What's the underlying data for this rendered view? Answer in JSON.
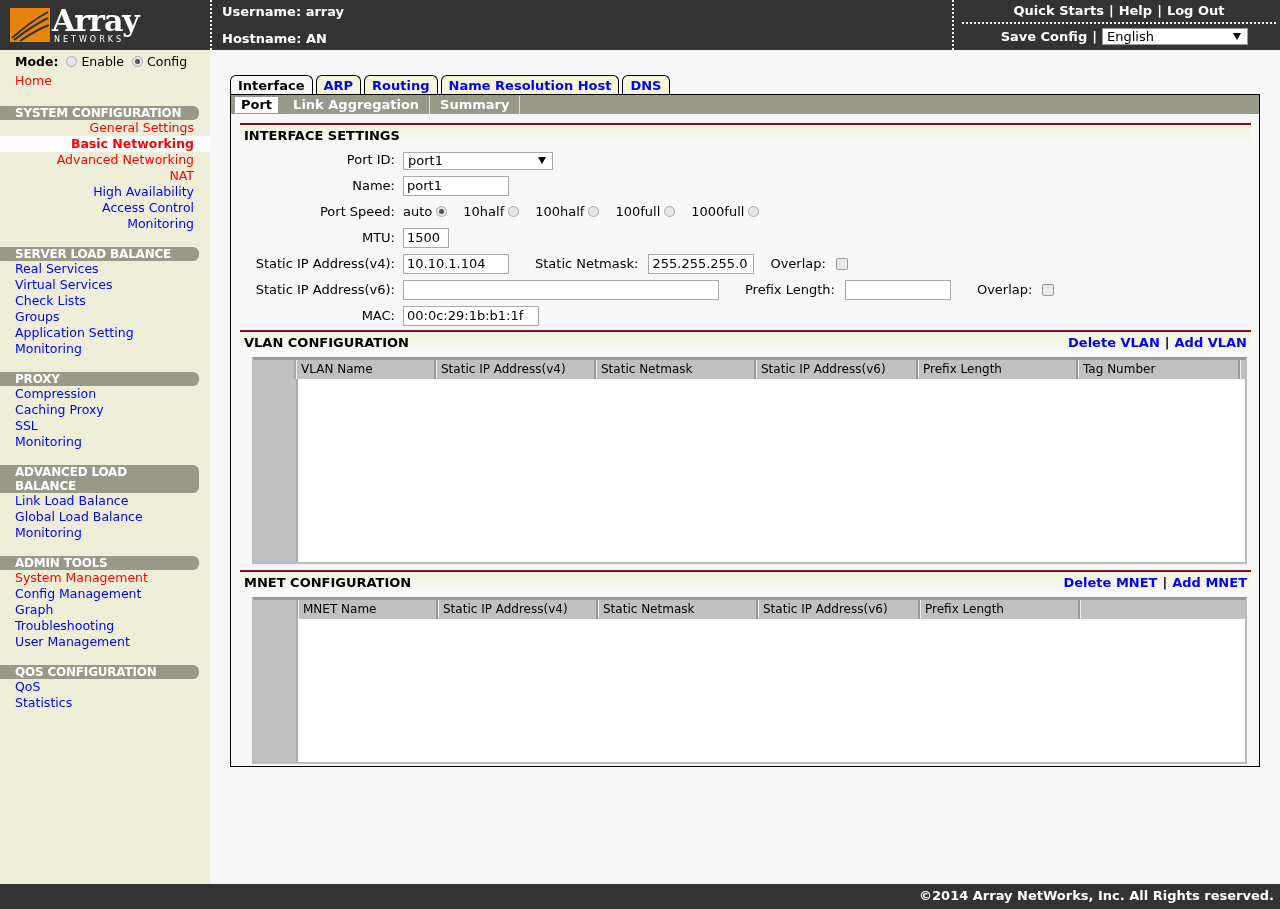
{
  "header": {
    "logo": {
      "word": "Array",
      "subword": "NETWORKS"
    },
    "username": "Username: array",
    "hostname": "Hostname: AN",
    "top_links": [
      "Quick Starts",
      "Help",
      "Log Out"
    ],
    "top_separators": [
      "|",
      "|"
    ],
    "save_config": "Save Config",
    "save_separator": "|",
    "language": {
      "value": "English"
    }
  },
  "sidebar": {
    "mode_label": "Mode:",
    "modes": [
      {
        "label": "Enable",
        "selected": false
      },
      {
        "label": "Config",
        "selected": true
      }
    ],
    "home": {
      "label": "Home",
      "color": "#ff0000"
    },
    "sections": [
      {
        "title": "SYSTEM CONFIGURATION",
        "kind": "right",
        "items": [
          {
            "label": "General Settings",
            "color": "#ff0000",
            "selected": false
          },
          {
            "label": "Basic Networking",
            "color": "#ff0000",
            "selected": true
          },
          {
            "label": "Advanced Networking",
            "color": "#ff0000",
            "selected": false
          },
          {
            "label": "NAT",
            "color": "#ff0000",
            "selected": false
          },
          {
            "label": "High Availability",
            "color": "#0000ff",
            "selected": false
          },
          {
            "label": "Access Control",
            "color": "#0000ff",
            "selected": false
          },
          {
            "label": "Monitoring",
            "color": "#0000ff",
            "selected": false
          }
        ]
      },
      {
        "title": "SERVER LOAD BALANCE",
        "kind": "left",
        "items": [
          {
            "label": "Real Services",
            "color": "#0000ff",
            "selected": false
          },
          {
            "label": "Virtual Services",
            "color": "#0000ff",
            "selected": false
          },
          {
            "label": "Check Lists",
            "color": "#0000ff",
            "selected": false
          },
          {
            "label": "Groups",
            "color": "#0000ff",
            "selected": false
          },
          {
            "label": "Application Setting",
            "color": "#0000ff",
            "selected": false
          },
          {
            "label": "Monitoring",
            "color": "#0000ff",
            "selected": false
          }
        ]
      },
      {
        "title": "PROXY",
        "kind": "left",
        "items": [
          {
            "label": "Compression",
            "color": "#0000ff",
            "selected": false
          },
          {
            "label": "Caching Proxy",
            "color": "#0000ff",
            "selected": false
          },
          {
            "label": "SSL",
            "color": "#0000ff",
            "selected": false
          },
          {
            "label": "Monitoring",
            "color": "#0000ff",
            "selected": false
          }
        ]
      },
      {
        "title": "ADVANCED LOAD BALANCE",
        "kind": "left",
        "items": [
          {
            "label": "Link Load Balance",
            "color": "#0000ff",
            "selected": false
          },
          {
            "label": "Global Load Balance",
            "color": "#0000ff",
            "selected": false
          },
          {
            "label": "Monitoring",
            "color": "#0000ff",
            "selected": false
          }
        ]
      },
      {
        "title": "ADMIN TOOLS",
        "kind": "left",
        "items": [
          {
            "label": "System Management",
            "color": "#ff0000",
            "selected": false
          },
          {
            "label": "Config Management",
            "color": "#0000ff",
            "selected": false
          },
          {
            "label": "Graph",
            "color": "#0000ff",
            "selected": false
          },
          {
            "label": "Troubleshooting",
            "color": "#0000ff",
            "selected": false
          },
          {
            "label": "User Management",
            "color": "#0000ff",
            "selected": false
          }
        ]
      },
      {
        "title": "QOS CONFIGURATION",
        "kind": "left",
        "items": [
          {
            "label": "QoS",
            "color": "#0000ff",
            "selected": false
          },
          {
            "label": "Statistics",
            "color": "#0000ff",
            "selected": false
          }
        ]
      }
    ]
  },
  "tabs": [
    {
      "label": "Interface",
      "selected": true
    },
    {
      "label": "ARP",
      "selected": false
    },
    {
      "label": "Routing",
      "selected": false
    },
    {
      "label": "Name Resolution Host",
      "selected": false
    },
    {
      "label": "DNS",
      "selected": false
    }
  ],
  "subtabs": [
    {
      "label": "Port",
      "selected": true
    },
    {
      "label": "Link Aggregation",
      "selected": false
    },
    {
      "label": "Summary",
      "selected": false
    }
  ],
  "interface_settings": {
    "title": "INTERFACE SETTINGS",
    "port_id": {
      "label": "Port ID:",
      "value": "port1"
    },
    "name": {
      "label": "Name:",
      "value": "port1"
    },
    "port_speed": {
      "label": "Port Speed:",
      "options": [
        {
          "label": "auto",
          "selected": true
        },
        {
          "label": "10half",
          "selected": false
        },
        {
          "label": "100half",
          "selected": false
        },
        {
          "label": "100full",
          "selected": false
        },
        {
          "label": "1000full",
          "selected": false
        }
      ]
    },
    "mtu": {
      "label": "MTU:",
      "value": "1500"
    },
    "ipv4": {
      "label": "Static IP Address(v4):",
      "value": "10.10.1.104",
      "netmask_label": "Static Netmask:",
      "netmask": "255.255.255.0",
      "overlap_label": "Overlap:",
      "overlap_checked": false
    },
    "ipv6": {
      "label": "Static IP Address(v6):",
      "prefix_label": "Prefix Length:",
      "overlap_label": "Overlap:",
      "overlap_checked": false
    },
    "mac": {
      "label": "MAC:",
      "value": "00:0c:29:1b:b1:1f"
    }
  },
  "vlan": {
    "title": "VLAN CONFIGURATION",
    "actions": [
      "Delete VLAN",
      "Add VLAN"
    ],
    "separator": "|",
    "columns": [
      "VLAN Name",
      "Static IP Address(v4)",
      "Static Netmask",
      "Static IP Address(v6)",
      "Prefix Length",
      "Tag Number"
    ]
  },
  "mnet": {
    "title": "MNET CONFIGURATION",
    "actions": [
      "Delete MNET",
      "Add MNET"
    ],
    "separator": "|",
    "columns": [
      "MNET Name",
      "Static IP Address(v4)",
      "Static Netmask",
      "Static IP Address(v6)",
      "Prefix Length"
    ]
  },
  "footer": "©2014 Array NetWorks, Inc. All Rights reserved."
}
